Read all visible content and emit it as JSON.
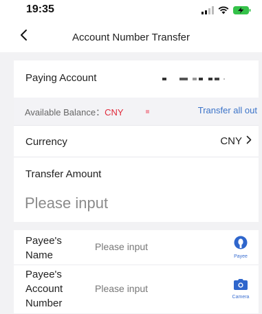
{
  "status_bar": {
    "time": "19:35"
  },
  "nav": {
    "title": "Account Number Transfer"
  },
  "paying_account": {
    "label": "Paying Account"
  },
  "balance": {
    "label": "Available Balance：",
    "currency": "CNY",
    "transfer_all": "Transfer all out"
  },
  "currency": {
    "label": "Currency",
    "value": "CNY"
  },
  "amount": {
    "label": "Transfer Amount",
    "placeholder": "Please input"
  },
  "payee_name": {
    "label_line1": "Payee's",
    "label_line2": "Name",
    "placeholder": "Please input",
    "button_caption": "Payee"
  },
  "payee_account": {
    "label_line1": "Payee's",
    "label_line2": "Account",
    "label_line3": "Number",
    "placeholder": "Please input",
    "button_caption": "Camera"
  },
  "colors": {
    "accent_blue": "#3b73c8",
    "balance_red": "#e0293a",
    "battery_green": "#35c24a"
  },
  "icons": [
    "back-chevron-icon",
    "signal-icon",
    "wifi-icon",
    "battery-charging-icon",
    "chevron-right-icon",
    "person-icon",
    "camera-icon"
  ]
}
